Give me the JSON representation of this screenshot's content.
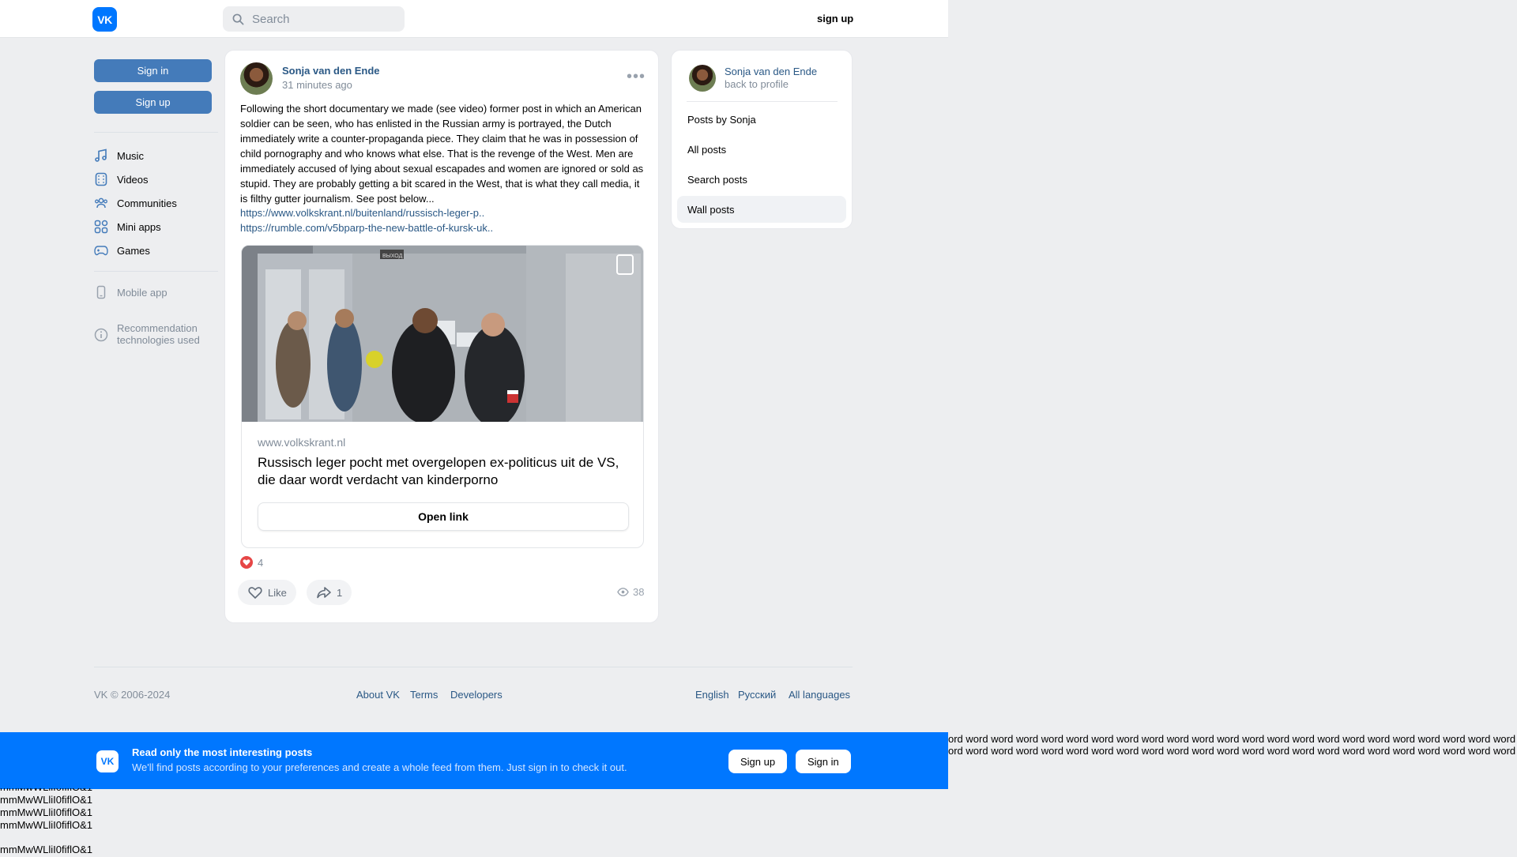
{
  "header": {
    "logo_text": "VK",
    "search_placeholder": "Search",
    "signup_label": "sign up"
  },
  "left_nav": {
    "signin_label": "Sign in",
    "signup_label": "Sign up",
    "items": [
      {
        "label": "Music",
        "icon": "music-icon"
      },
      {
        "label": "Videos",
        "icon": "videos-icon"
      },
      {
        "label": "Communities",
        "icon": "communities-icon"
      },
      {
        "label": "Mini apps",
        "icon": "mini-apps-icon"
      },
      {
        "label": "Games",
        "icon": "games-icon"
      }
    ],
    "mobile_app_label": "Mobile app",
    "recommendation_line1": "Recommendation",
    "recommendation_line2": "technologies used"
  },
  "post": {
    "author": "Sonja van den Ende",
    "time": "31 minutes ago",
    "text": "Following the short documentary we made (see video) former post in which an American soldier can be seen, who has enlisted in the Russian army is portrayed, the Dutch immediately write a counter-propaganda piece. They claim that he was in possession of child pornography and who knows what else. That is the revenge of the West. Men are immediately accused of lying about sexual escapades and women are ignored or sold as stupid. They are probably getting a bit scared in the West, that is what they call media, it is filthy gutter journalism. See post below...",
    "links": [
      "https://www.volkskrant.nl/buitenland/russisch-leger-p..",
      "https://rumble.com/v5bparp-the-new-battle-of-kursk-uk.."
    ],
    "attachment": {
      "domain": "www.volkskrant.nl",
      "title": "Russisch leger pocht met overgelopen ex-politicus uit de VS, die daar wordt verdacht van kinderporno",
      "open_label": "Open link",
      "photo_sign": "ВЫХОД"
    },
    "reaction_count": "4",
    "like_label": "Like",
    "share_count": "1",
    "views": "38"
  },
  "right_card": {
    "name": "Sonja van den Ende",
    "back_label": "back to profile",
    "items": [
      {
        "label": "Posts by Sonja",
        "active": false
      },
      {
        "label": "All posts",
        "active": false
      },
      {
        "label": "Search posts",
        "active": false
      },
      {
        "label": "Wall posts",
        "active": true
      }
    ]
  },
  "footer": {
    "copyright": "VK © 2006-2024",
    "links": [
      "About VK",
      "Terms",
      "Developers"
    ],
    "languages": [
      "English",
      "Русский",
      "All languages"
    ]
  },
  "banner": {
    "logo_text": "VK",
    "title": "Read only the most interesting posts",
    "subtitle": "We'll find posts according to your preferences and create a whole feed from them. Just sign in to check it out.",
    "signup_label": "Sign up",
    "signin_label": "Sign in"
  },
  "overflow_text": {
    "words_line": "ord word word word word word word word word word word word word word word word word word word word word word word word word word word w",
    "font_test": "mmMwWLliI0fiflO&1"
  },
  "colors": {
    "vk_blue": "#0077ff",
    "button_blue": "#447bba",
    "link": "#2a5885",
    "background": "#edeef0"
  }
}
